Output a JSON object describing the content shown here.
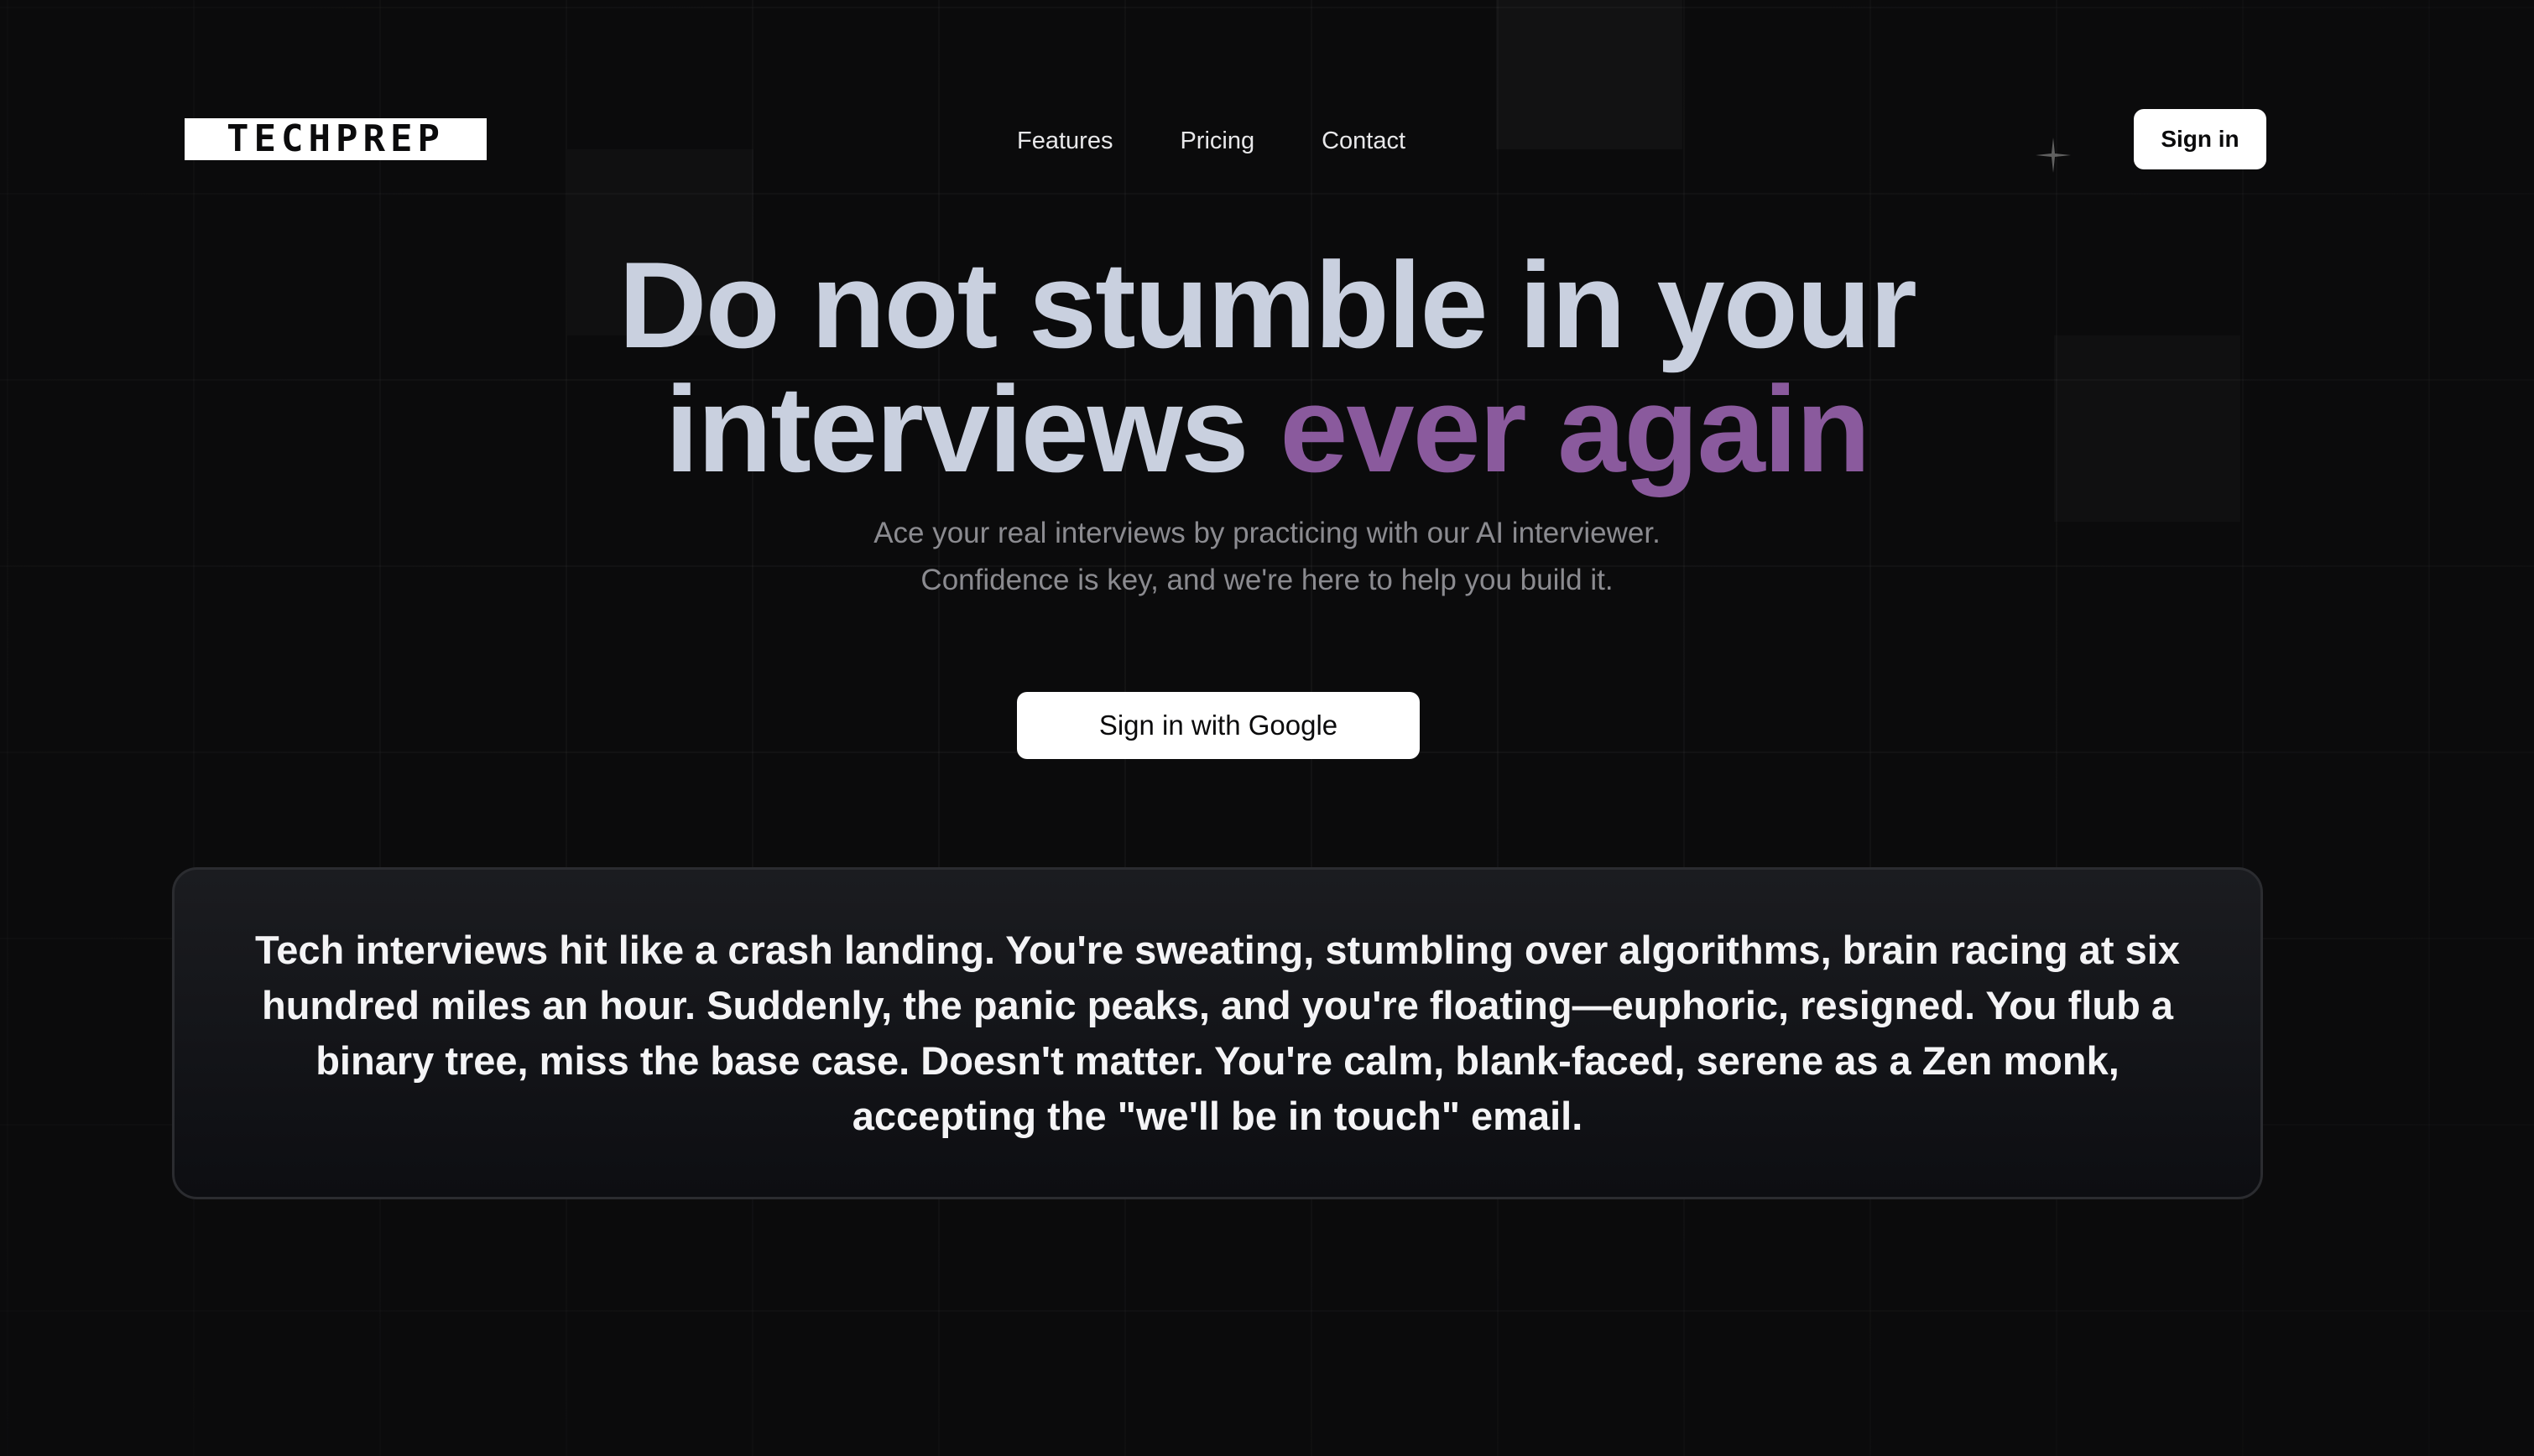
{
  "brand": {
    "logo_text": "TECHPREP"
  },
  "nav": {
    "items": [
      {
        "label": "Features"
      },
      {
        "label": "Pricing"
      },
      {
        "label": "Contact"
      }
    ],
    "signin_label": "Sign in"
  },
  "hero": {
    "headline_part1": "Do not stumble in your",
    "headline_part2": "interviews",
    "headline_accent": "ever again",
    "subtitle_line1": "Ace your real interviews by practicing with our AI interviewer.",
    "subtitle_line2": "Confidence is key, and we're here to help you build it.",
    "cta_label": "Sign in with Google"
  },
  "quote": {
    "text": "Tech interviews hit like a crash landing. You're sweating, stumbling over algorithms, brain racing at six hundred miles an hour. Suddenly, the panic peaks, and you're floating—euphoric, resigned. You flub a binary tree, miss the base case. Doesn't matter. You're calm, blank-faced, serene as a Zen monk, accepting the \"we'll be in touch\" email."
  },
  "colors": {
    "background": "#0b0b0c",
    "headline": "#c9d0df",
    "accent": "#8a5a9d",
    "subtitle": "#8b8b90"
  },
  "icons": {
    "sparkle": "sparkle-icon"
  }
}
